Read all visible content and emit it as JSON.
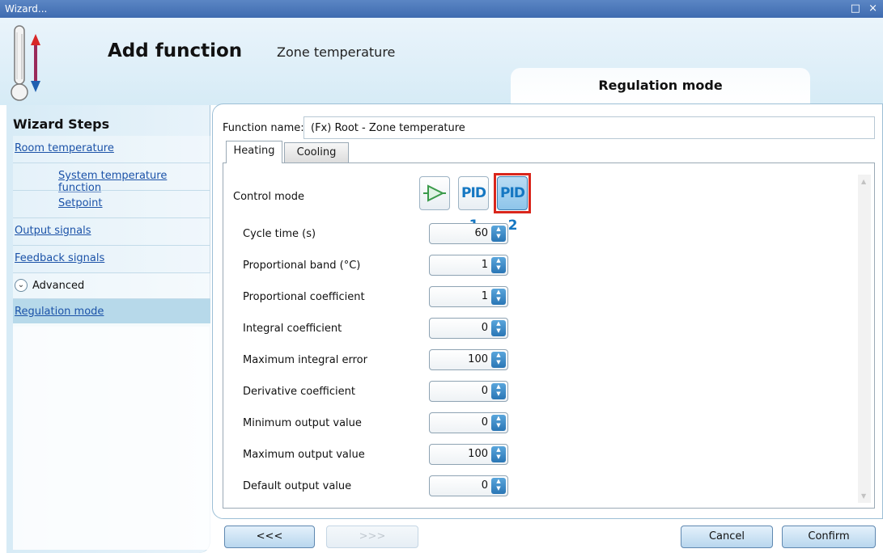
{
  "window": {
    "title": "Wizard...",
    "controls": "□ ×"
  },
  "header": {
    "title": "Add function",
    "subtitle": "Zone temperature",
    "step_title": "Regulation mode",
    "icon": "thermometer-arrows-icon"
  },
  "sidebar": {
    "title": "Wizard Steps",
    "items": [
      {
        "label": "Room temperature",
        "level": 0
      },
      {
        "label": "System temperature function",
        "level": 1
      },
      {
        "label": "Setpoint",
        "level": 1
      },
      {
        "label": "Output signals",
        "level": 0
      },
      {
        "label": "Feedback signals",
        "level": 0
      }
    ],
    "advanced_label": "Advanced",
    "selected_item": "Regulation mode"
  },
  "form": {
    "function_name_label": "Function name:",
    "function_name_value": "(Fx) Root - Zone temperature",
    "tabs": [
      "Heating",
      "Cooling"
    ],
    "active_tab": "Heating",
    "control_mode_label": "Control mode",
    "control_modes": [
      {
        "name": "on-off-icon",
        "label": ""
      },
      {
        "name": "pid1",
        "label": "PID 1"
      },
      {
        "name": "pid2",
        "label": "PID 2"
      }
    ],
    "selected_control_mode": "PID 2",
    "params": [
      {
        "label": "Cycle time (s)",
        "value": "60"
      },
      {
        "label": "Proportional band (°C)",
        "value": "1"
      },
      {
        "label": "Proportional coefficient",
        "value": "1"
      },
      {
        "label": "Integral coefficient",
        "value": "0"
      },
      {
        "label": "Maximum integral error",
        "value": "100"
      },
      {
        "label": "Derivative coefficient",
        "value": "0"
      },
      {
        "label": "Minimum output value",
        "value": "0"
      },
      {
        "label": "Maximum output value",
        "value": "100"
      },
      {
        "label": "Default output value",
        "value": "0"
      }
    ]
  },
  "footer": {
    "back_label": "<<<",
    "next_label": ">>>",
    "cancel_label": "Cancel",
    "confirm_label": "Confirm"
  },
  "colors": {
    "highlight": "#d9261c",
    "accent": "#2a76b5",
    "link": "#1b52a8"
  }
}
